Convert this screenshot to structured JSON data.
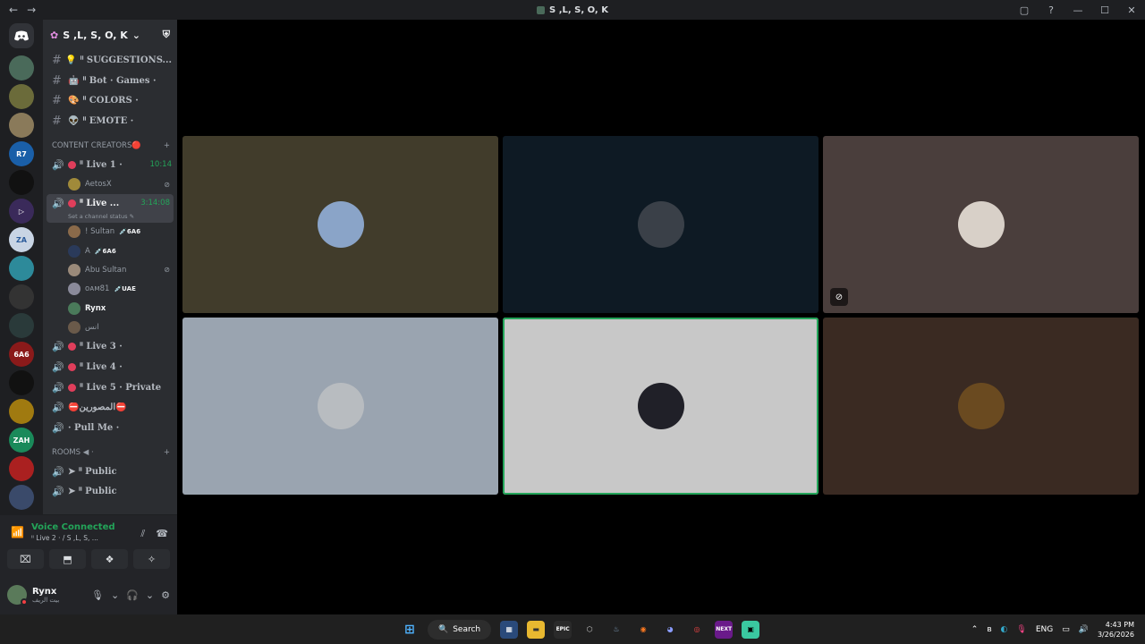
{
  "window": {
    "title": "S ,L, S, O, K",
    "back": "←",
    "forward": "→",
    "controls": [
      "▢",
      "?",
      "—",
      "☐",
      "✕"
    ]
  },
  "server": {
    "name": "S ,L, S, O, K"
  },
  "server_icons": [
    {
      "label": "",
      "color": "#4a6a5a"
    },
    {
      "label": "",
      "color": "#6b6b3a"
    },
    {
      "label": "",
      "color": "#8a7a5a"
    },
    {
      "label": "R7",
      "color": "#1a5fa8"
    },
    {
      "label": "",
      "color": "#111"
    },
    {
      "label": "▷",
      "color": "#3a2a5a"
    },
    {
      "label": "ZA",
      "color": "#c8d4e4"
    },
    {
      "label": "",
      "color": "#2d8a9a"
    },
    {
      "label": "",
      "color": "#333"
    },
    {
      "label": "",
      "color": "#2a3a3a"
    },
    {
      "label": "6A6",
      "color": "#8a1a1a"
    },
    {
      "label": "",
      "color": "#111"
    },
    {
      "label": "",
      "color": "#a07a10"
    },
    {
      "label": "ZAH",
      "color": "#1a8a5a"
    },
    {
      "label": "",
      "color": "#aa2020"
    },
    {
      "label": "",
      "color": "#3a4a6a"
    }
  ],
  "text_channels": [
    {
      "emoji": "💡",
      "name": "ᑊᑊ SUGGESTIONS..."
    },
    {
      "emoji": "🤖",
      "name": "ᑊᑊ Bot · Games ·"
    },
    {
      "emoji": "🎨",
      "name": "ᑊᑊ COLORS ·"
    },
    {
      "emoji": "👽",
      "name": "ᑊᑊ EMOTE ·"
    }
  ],
  "categories": {
    "content": "CONTENT CREATORS🔴",
    "rooms": "ROOMS ◀ ·",
    "add": "+"
  },
  "live1": {
    "name": "ᑊᑊ Live 1 ·",
    "timer": "10:14",
    "members": [
      {
        "name": "AetosX",
        "tag": ""
      }
    ]
  },
  "live2": {
    "name": "ᑊᑊ Live ...",
    "timer": "3:14:08",
    "status": "Set a channel status ✎",
    "members": [
      {
        "name": "! Sultan",
        "tag": "💉6A6"
      },
      {
        "name": "A",
        "tag": "💉6A6"
      },
      {
        "name": "Abu Sultan",
        "tag": ""
      },
      {
        "name": "ᴏᴀᴍ81",
        "tag": "💉UAE"
      },
      {
        "name": "Rynx",
        "tag": ""
      },
      {
        "name": "انس",
        "tag": ""
      }
    ]
  },
  "voice_channels": [
    {
      "name": "ᑊᑊ Live 3 ·"
    },
    {
      "name": "ᑊᑊ Live 4 ·"
    },
    {
      "name": "ᑊᑊ Live 5 · Private"
    },
    {
      "name": "⛔المصورين⛔"
    },
    {
      "name": "· Pull Me ·"
    }
  ],
  "rooms": [
    {
      "name": "➤ ᑊᑊ Public"
    },
    {
      "name": "➤ ᑊᑊ Public"
    }
  ],
  "voice_panel": {
    "title": "Voice Connected",
    "subtitle": "ᑊᑊ Live 2 · / S ,L, S, ..."
  },
  "user": {
    "name": "Rynx",
    "status": "بيت الريف"
  },
  "tiles": [
    {
      "bg": "#413c2b",
      "av": "#8aa4c8",
      "muted": false,
      "speaking": false
    },
    {
      "bg": "#0e1a24",
      "av": "#3a4048",
      "muted": false,
      "speaking": false
    },
    {
      "bg": "#4a3e3c",
      "av": "#d8d0c8",
      "muted": true,
      "speaking": false
    },
    {
      "bg": "#9aa4b0",
      "av": "#b8bcc0",
      "muted": false,
      "speaking": false
    },
    {
      "bg": "#c8c8c8",
      "av": "#202028",
      "muted": false,
      "speaking": true
    },
    {
      "bg": "#3a2a22",
      "av": "#6a4a20",
      "muted": false,
      "speaking": false
    }
  ],
  "taskbar": {
    "search": "Search",
    "lang": "ENG",
    "time": "4:43 PM",
    "date": "3/26/2026"
  }
}
